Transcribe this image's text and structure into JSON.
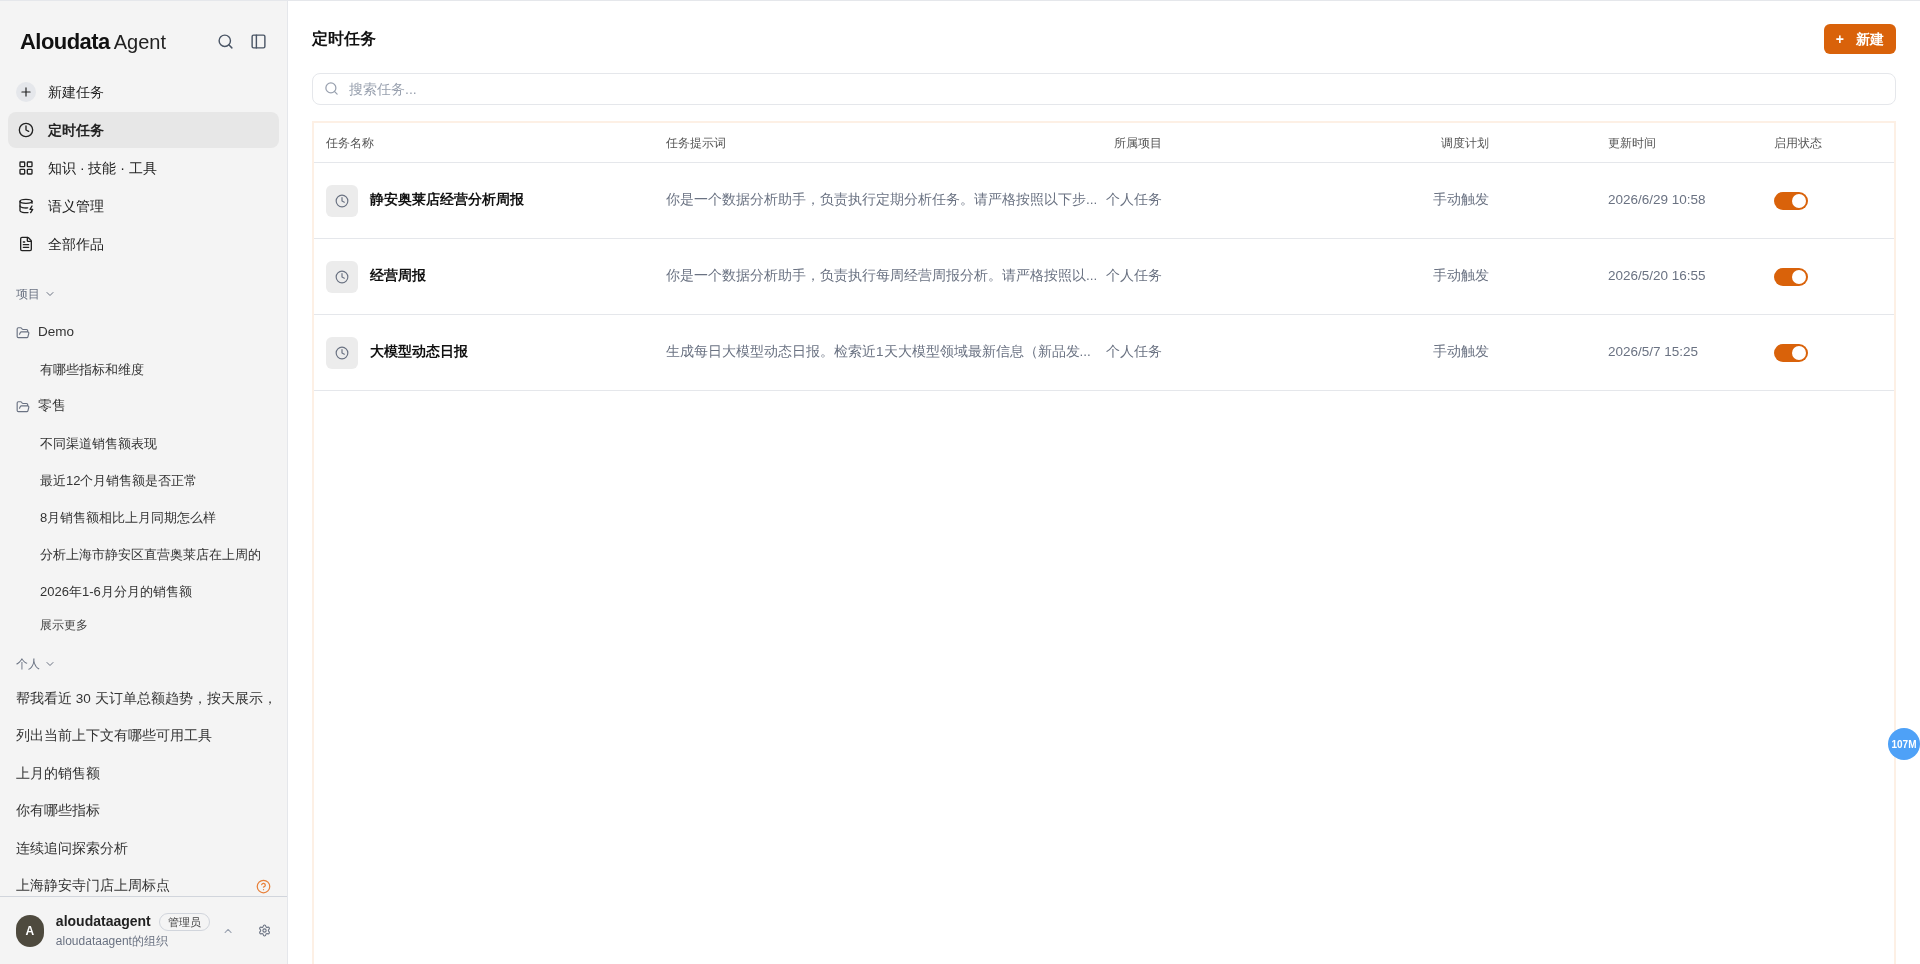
{
  "sidebar": {
    "logo": {
      "brand": "Aloudata",
      "product": "Agent"
    },
    "nav": [
      {
        "kind": "new",
        "label": "新建任务",
        "selected": false
      },
      {
        "kind": "clock",
        "label": "定时任务",
        "selected": true
      },
      {
        "kind": "grid",
        "label": "知识 · 技能 · 工具",
        "selected": false
      },
      {
        "kind": "database",
        "label": "语义管理",
        "selected": false
      },
      {
        "kind": "file",
        "label": "全部作品",
        "selected": false
      }
    ],
    "projects": {
      "title": "项目",
      "expanded": true,
      "folders": [
        {
          "name": "Demo",
          "items": [
            "有哪些指标和维度"
          ]
        },
        {
          "name": "零售",
          "items": [
            "不同渠道销售额表现",
            "最近12个月销售额是否正常",
            "8月销售额相比上月同期怎么样",
            "分析上海市静安区直营奥莱店在上周的",
            "2026年1-6月分月的销售额"
          ]
        }
      ],
      "more": "展示更多"
    },
    "personal": {
      "title": "个人",
      "expanded": true,
      "items": [
        {
          "label": "帮我看近 30 天订单总额趋势，按天展示，",
          "help": false
        },
        {
          "label": "列出当前上下文有哪些可用工具",
          "help": false
        },
        {
          "label": "上月的销售额",
          "help": false
        },
        {
          "label": "你有哪些指标",
          "help": false
        },
        {
          "label": "连续追问探索分析",
          "help": false
        },
        {
          "label": "上海静安寺门店上周标点",
          "help": true
        }
      ]
    },
    "user": {
      "initial": "A",
      "name": "aloudataagent",
      "role": "管理员",
      "org": "aloudataagent的组织"
    }
  },
  "main": {
    "title": "定时任务",
    "new_button": {
      "icon": "+",
      "label": "新建"
    },
    "search": {
      "placeholder": "搜索任务..."
    },
    "table": {
      "columns": [
        "任务名称",
        "任务提示词",
        "所属项目",
        "调度计划",
        "更新时间",
        "启用状态"
      ],
      "rows": [
        {
          "name": "静安奥莱店经营分析周报",
          "prompt": "你是一个数据分析助手，负责执行定期分析任务。请严格按照以下步...",
          "project": "个人任务",
          "schedule": "手动触发",
          "updated": "2026/6/29 10:58",
          "on": true
        },
        {
          "name": "经营周报",
          "prompt": "你是一个数据分析助手，负责执行每周经营周报分析。请严格按照以...",
          "project": "个人任务",
          "schedule": "手动触发",
          "updated": "2026/5/20 16:55",
          "on": true
        },
        {
          "name": "大模型动态日报",
          "prompt": "生成每日大模型动态日报。检索近1天大模型领域最新信息（新品发...",
          "project": "个人任务",
          "schedule": "手动触发",
          "updated": "2026/5/7 15:25",
          "on": true
        }
      ]
    }
  },
  "memory_badge": "107M"
}
